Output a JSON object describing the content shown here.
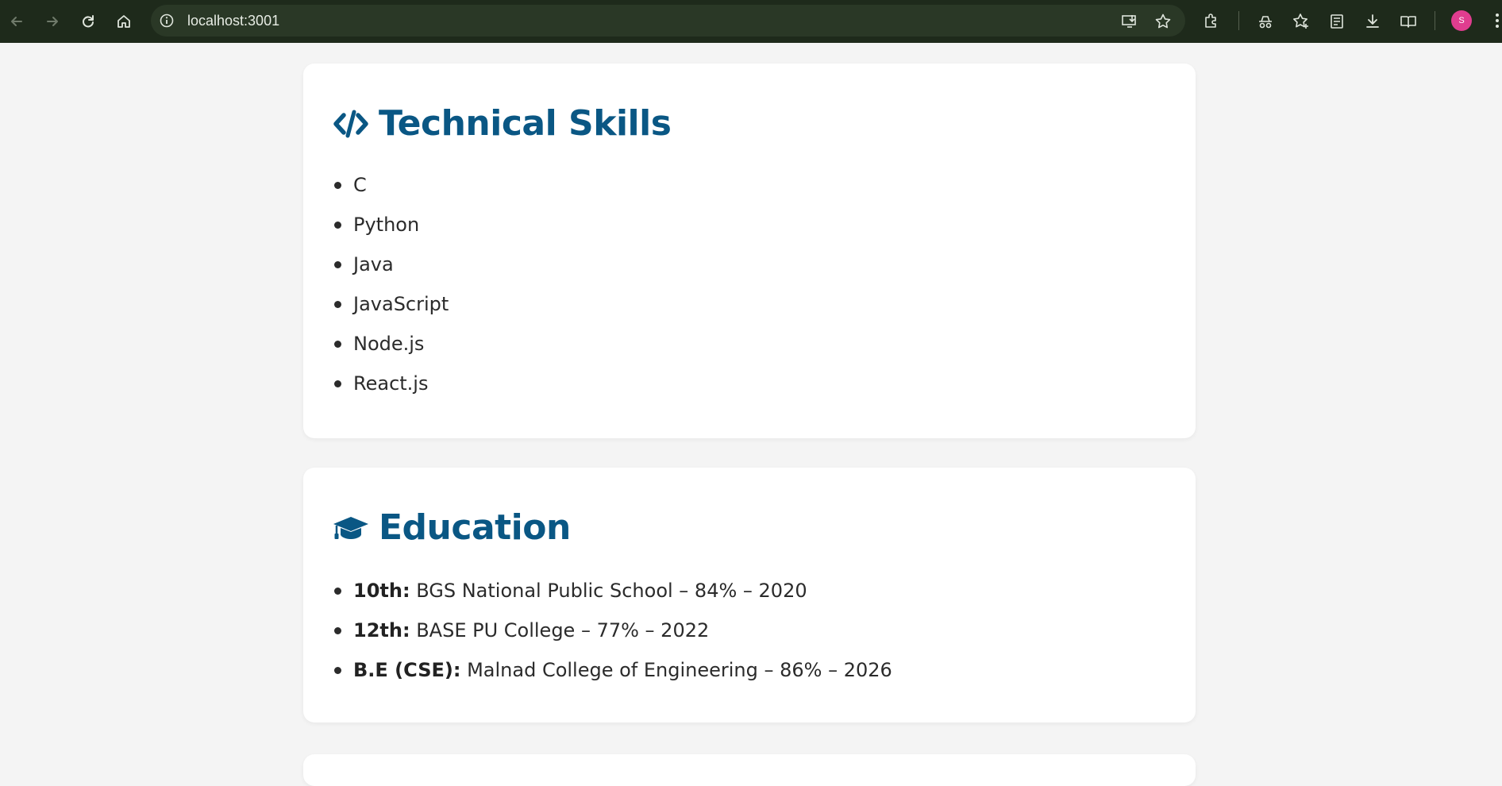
{
  "browser": {
    "url": "localhost:3001",
    "avatar_letter": "S",
    "icons": [
      "back-icon",
      "forward-icon",
      "reload-icon",
      "home-icon",
      "site-info-icon",
      "install-app-icon",
      "bookmark-star-icon",
      "extensions-icon",
      "incognito-icon",
      "favorites-icon",
      "collections-icon",
      "downloads-icon",
      "reading-view-icon",
      "more-menu-icon"
    ]
  },
  "skills": {
    "title": "Technical Skills",
    "icon": "code-icon",
    "items": [
      "C",
      "Python",
      "Java",
      "JavaScript",
      "Node.js",
      "React.js"
    ]
  },
  "education": {
    "title": "Education",
    "icon": "graduation-cap-icon",
    "items": [
      {
        "label": "10th:",
        "text": "BGS National Public School – 84% – 2020"
      },
      {
        "label": "12th:",
        "text": "BASE PU College – 77% – 2022"
      },
      {
        "label": "B.E (CSE):",
        "text": "Malnad College of Engineering – 86% – 2026"
      }
    ]
  },
  "colors": {
    "chrome_bg": "#1e2a1b",
    "page_bg": "#f4f4f4",
    "title_blue": "#0a5784",
    "avatar": "#e03d8f"
  }
}
